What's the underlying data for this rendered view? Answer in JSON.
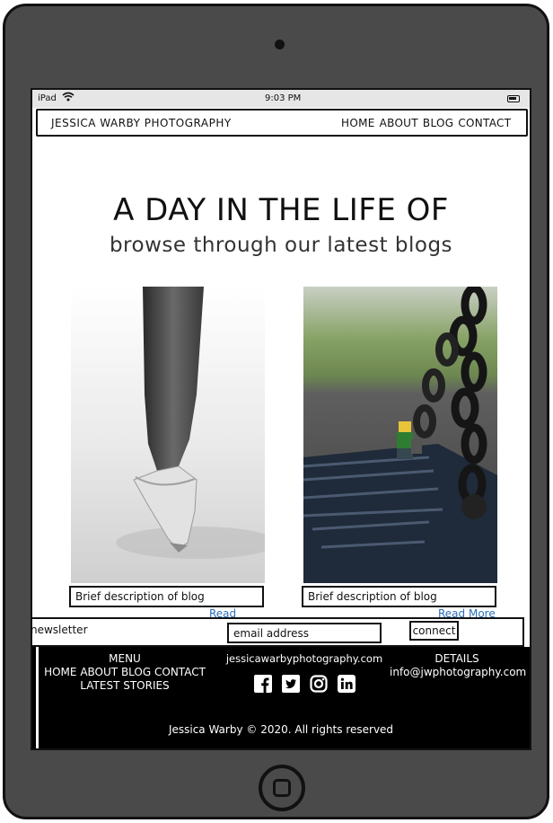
{
  "status_bar": {
    "carrier": "iPad",
    "time": "9:03 PM"
  },
  "header": {
    "brand": "JESSICA WARBY PHOTOGRAPHY",
    "nav": [
      "HOME",
      "ABOUT",
      "BLOG",
      "CONTACT"
    ]
  },
  "hero": {
    "title": "A DAY IN THE LIFE OF",
    "subtitle": "browse through our latest blogs"
  },
  "posts": [
    {
      "description": "Brief description of blog",
      "read_more": "Read More"
    },
    {
      "description": "Brief description of blog",
      "read_more": "Read More"
    }
  ],
  "newsletter": {
    "label": "newsletter",
    "email_placeholder": "email address",
    "button": "connect"
  },
  "footer": {
    "menu_heading": "MENU",
    "menu_links": [
      "HOME",
      "ABOUT",
      "BLOG",
      "CONTACT"
    ],
    "latest_stories": "LATEST STORIES",
    "website": "jessicawarbyphotography.com",
    "social": [
      "facebook-icon",
      "twitter-icon",
      "instagram-icon",
      "linkedin-icon"
    ],
    "details_heading": "DETAILS",
    "email": "info@jwphotography.com",
    "copyright": "Jessica Warby © 2020. All rights reserved"
  }
}
